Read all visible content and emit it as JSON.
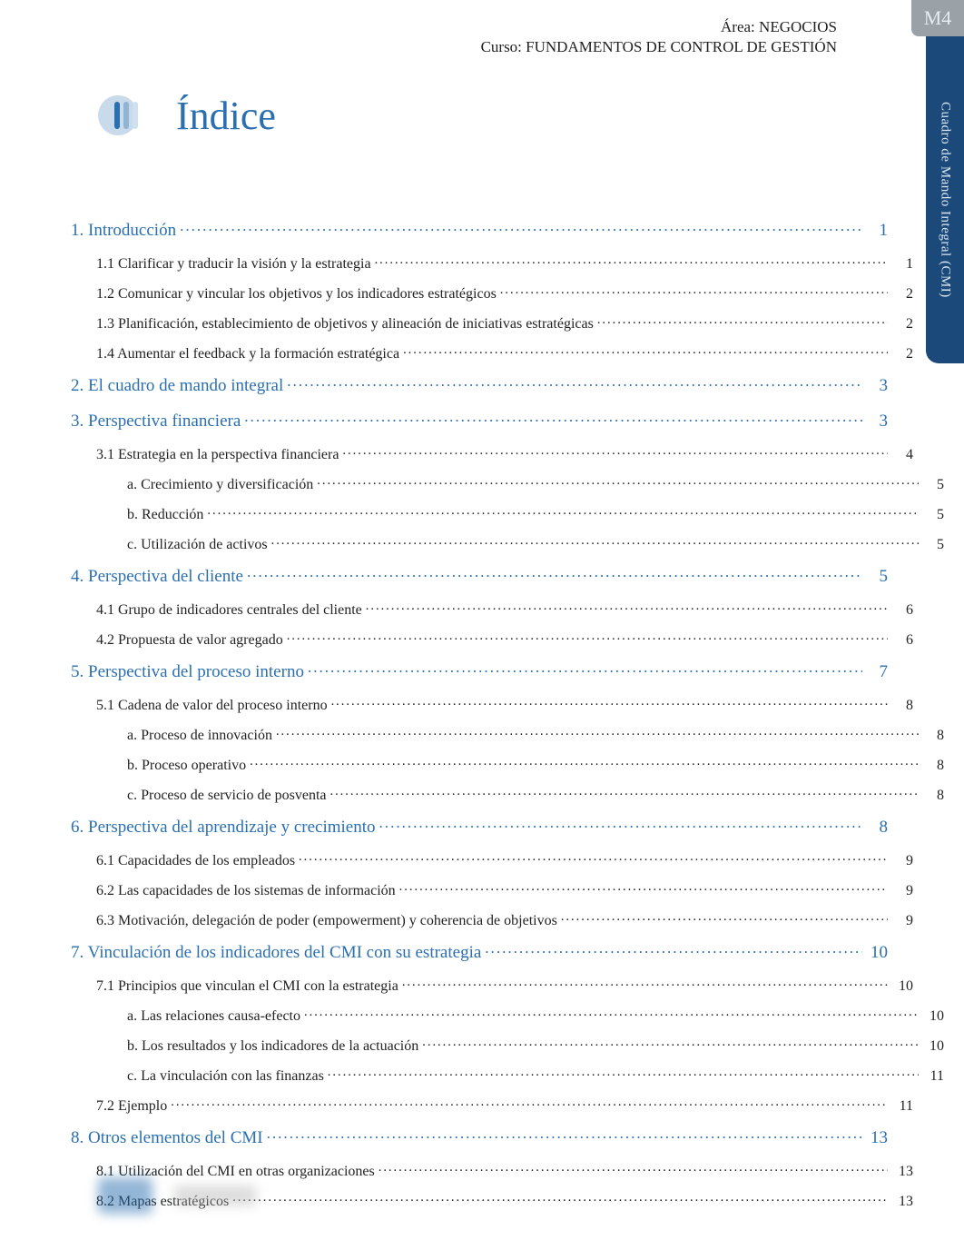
{
  "header": {
    "area_label": "Área:",
    "area_value": "NEGOCIOS",
    "curso_label": "Curso:",
    "curso_value": "FUNDAMENTOS DE CONTROL DE GESTIÓN"
  },
  "side": {
    "module": "M4",
    "title": "Cuadro de Mando Integral (CMI)"
  },
  "title": "Índice",
  "toc": [
    {
      "level": 1,
      "label": "1. Introducción",
      "page": "1"
    },
    {
      "level": 2,
      "label": "1.1 Clarificar y traducir la visión y la estrategia",
      "page": "1"
    },
    {
      "level": 2,
      "label": "1.2 Comunicar y vincular los objetivos y los indicadores estratégicos",
      "page": "2"
    },
    {
      "level": 2,
      "label": "1.3 Planificación, establecimiento de objetivos y alineación de iniciativas estratégicas",
      "page": "2"
    },
    {
      "level": 2,
      "label": "1.4 Aumentar el feedback y la formación estratégica",
      "page": "2"
    },
    {
      "level": 1,
      "label": "2. El cuadro de mando integral",
      "page": "3"
    },
    {
      "level": 1,
      "label": "3. Perspectiva financiera",
      "page": "3"
    },
    {
      "level": 2,
      "label": "3.1 Estrategia en la perspectiva financiera",
      "page": "4"
    },
    {
      "level": 3,
      "label": "a. Crecimiento y diversificación",
      "page": "5"
    },
    {
      "level": 3,
      "label": "b. Reducción",
      "page": "5"
    },
    {
      "level": 3,
      "label": "c. Utilización de activos",
      "page": "5"
    },
    {
      "level": 1,
      "label": "4. Perspectiva del cliente",
      "page": "5"
    },
    {
      "level": 2,
      "label": "4.1 Grupo de indicadores centrales del cliente",
      "page": "6"
    },
    {
      "level": 2,
      "label": "4.2 Propuesta de valor agregado",
      "page": "6"
    },
    {
      "level": 1,
      "label": "5. Perspectiva del proceso interno",
      "page": "7"
    },
    {
      "level": 2,
      "label": "5.1 Cadena de valor del proceso interno",
      "page": "8"
    },
    {
      "level": 3,
      "label": "a. Proceso de innovación",
      "page": "8"
    },
    {
      "level": 3,
      "label": "b. Proceso operativo",
      "page": "8"
    },
    {
      "level": 3,
      "label": "c. Proceso de servicio de posventa",
      "page": "8"
    },
    {
      "level": 1,
      "label": "6. Perspectiva del aprendizaje y crecimiento",
      "page": "8"
    },
    {
      "level": 2,
      "label": "6.1 Capacidades de los empleados",
      "page": "9"
    },
    {
      "level": 2,
      "label": "6.2 Las capacidades de los sistemas de información",
      "page": "9"
    },
    {
      "level": 2,
      "label": "6.3 Motivación, delegación de poder (empowerment) y coherencia de objetivos",
      "page": "9"
    },
    {
      "level": 1,
      "label": "7. Vinculación de los indicadores del CMI con su estrategia",
      "page": "10"
    },
    {
      "level": 2,
      "label": "7.1 Principios que vinculan el CMI con la estrategia",
      "page": "10"
    },
    {
      "level": 3,
      "label": "a. Las relaciones causa-efecto",
      "page": "10"
    },
    {
      "level": 3,
      "label": "b. Los resultados y los indicadores de la actuación",
      "page": "10"
    },
    {
      "level": 3,
      "label": "c. La vinculación con las finanzas",
      "page": "11"
    },
    {
      "level": 2,
      "label": "7.2 Ejemplo",
      "page": "11"
    },
    {
      "level": 1,
      "label": "8. Otros elementos del CMI",
      "page": "13"
    },
    {
      "level": 2,
      "label": "8.1 Utilización del CMI en otras organizaciones",
      "page": "13"
    },
    {
      "level": 2,
      "label": "8.2 Mapas estratégicos",
      "page": "13"
    }
  ]
}
